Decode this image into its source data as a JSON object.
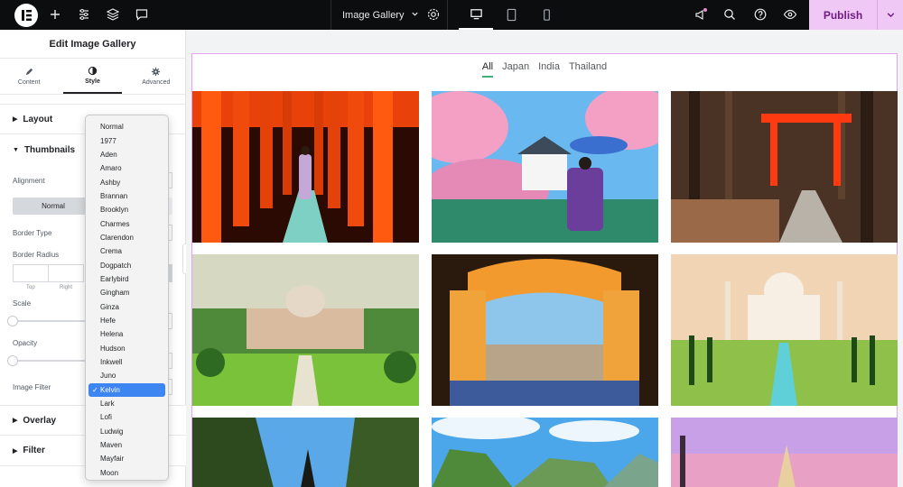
{
  "topbar": {
    "document_title": "Image Gallery",
    "publish_label": "Publish",
    "colors": {
      "bar": "#0c0d0e",
      "publish_bg": "#f0c8f6",
      "publish_text": "#6e1a7f"
    }
  },
  "panel": {
    "title": "Edit Image Gallery",
    "tabs": [
      {
        "label": "Content",
        "icon": "pencil-icon"
      },
      {
        "label": "Style",
        "icon": "half-circle-icon"
      },
      {
        "label": "Advanced",
        "icon": "gear-icon"
      }
    ],
    "active_tab": "Style",
    "sections": {
      "layout": "Layout",
      "thumbnails": "Thumbnails",
      "overlay": "Overlay",
      "filter": "Filter"
    },
    "controls": {
      "alignment": "Alignment",
      "normal": "Normal",
      "border_type": "Border Type",
      "border_radius": "Border Radius",
      "top": "Top",
      "right": "Right",
      "scale": "Scale",
      "opacity": "Opacity",
      "image_filter": "Image Filter"
    }
  },
  "dropdown": {
    "options": [
      "Normal",
      "1977",
      "Aden",
      "Amaro",
      "Ashby",
      "Brannan",
      "Brooklyn",
      "Charmes",
      "Clarendon",
      "Crema",
      "Dogpatch",
      "Earlybird",
      "Gingham",
      "Ginza",
      "Hefe",
      "Helena",
      "Hudson",
      "Inkwell",
      "Juno",
      "Kelvin",
      "Lark",
      "Lofi",
      "Ludwig",
      "Maven",
      "Mayfair",
      "Moon"
    ],
    "selected": "Kelvin",
    "check_mark": "✓"
  },
  "gallery": {
    "filters": [
      "All",
      "Japan",
      "India",
      "Thailand"
    ],
    "active_filter": "All",
    "accent": "#3bb27a"
  }
}
